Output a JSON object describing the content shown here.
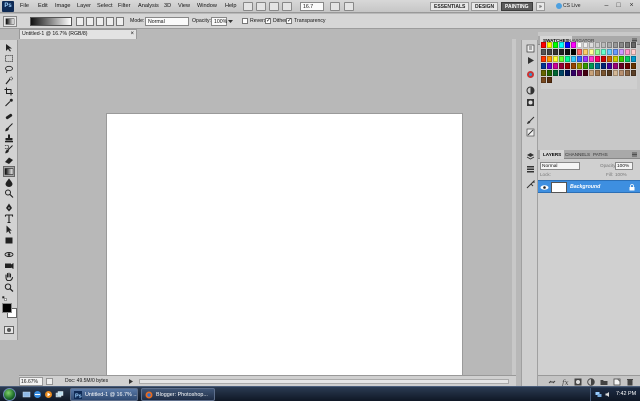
{
  "app": {
    "logo_text": "Ps"
  },
  "menu": {
    "items": [
      "File",
      "Edit",
      "Image",
      "Layer",
      "Select",
      "Filter",
      "Analysis",
      "3D",
      "View",
      "Window",
      "Help"
    ],
    "zoom_value": "16.7",
    "workspaces": {
      "essentials": "ESSENTIALS",
      "design": "DESIGN",
      "painting": "PAINTING",
      "more": "»"
    },
    "cs_live": "CS Live"
  },
  "options": {
    "mode_label": "Mode:",
    "mode_value": "Normal",
    "opacity_label": "Opacity:",
    "opacity_value": "100%",
    "reverse_label": "Reverse",
    "dither_label": "Dither",
    "transparency_label": "Transparency"
  },
  "document": {
    "tab_title": "Untitled-1 @ 16.7% (RGB/8)",
    "zoom": "16.67%",
    "doc_info": "Doc: 49.5M/0 bytes"
  },
  "swatches_panel": {
    "tabs": [
      "SWATCHES",
      "NAVIGATOR"
    ],
    "rows": [
      [
        "#ff0000",
        "#ffff00",
        "#00ff00",
        "#00ffff",
        "#0000ff",
        "#ff00ff",
        "#ffffff",
        "#eeeeee",
        "#dddddd",
        "#cccccc",
        "#bbbbbb",
        "#aaaaaa",
        "#999999",
        "#888888",
        "#777777",
        "#666666"
      ],
      [
        "#555555",
        "#444444",
        "#333333",
        "#222222",
        "#111111",
        "#000000",
        "#ff6666",
        "#ffcc66",
        "#ffff99",
        "#99ff99",
        "#66ffcc",
        "#66ccff",
        "#6699ff",
        "#cc99ff",
        "#ff99cc",
        "#ffcccc"
      ],
      [
        "#ff3300",
        "#ff9900",
        "#ffff33",
        "#66ff33",
        "#00ff99",
        "#33ccff",
        "#3366ff",
        "#9933ff",
        "#ff33cc",
        "#ff0066",
        "#cc0000",
        "#cc6600",
        "#cccc00",
        "#33cc00",
        "#00cc66",
        "#0099cc"
      ],
      [
        "#003399",
        "#6600cc",
        "#cc0099",
        "#990033",
        "#990000",
        "#994400",
        "#999900",
        "#339900",
        "#009955",
        "#006699",
        "#002277",
        "#440099",
        "#990077",
        "#660022",
        "#660000",
        "#663300"
      ],
      [
        "#666600",
        "#226600",
        "#006633",
        "#004466",
        "#001155",
        "#330066",
        "#660055",
        "#440011",
        "#c8a27a",
        "#a07850",
        "#7a5530",
        "#553a20",
        "#d4b896",
        "#b89070",
        "#8c6848",
        "#5c4028"
      ],
      [
        "#7a4a20",
        "#5a3010"
      ]
    ]
  },
  "layers_panel": {
    "tabs": [
      "LAYERS",
      "CHANNELS",
      "PATHS"
    ],
    "blend_mode": "Normal",
    "opacity_label": "Opacity:",
    "opacity_value": "100%",
    "lock_label": "Lock:",
    "fill_label": "Fill:",
    "fill_value": "100%",
    "layer_name": "Background"
  },
  "taskbar": {
    "buttons": [
      "Untitled-1 @ 16.7% ...",
      "Blogger: Photoshop..."
    ],
    "clock": "7:42 PM"
  }
}
